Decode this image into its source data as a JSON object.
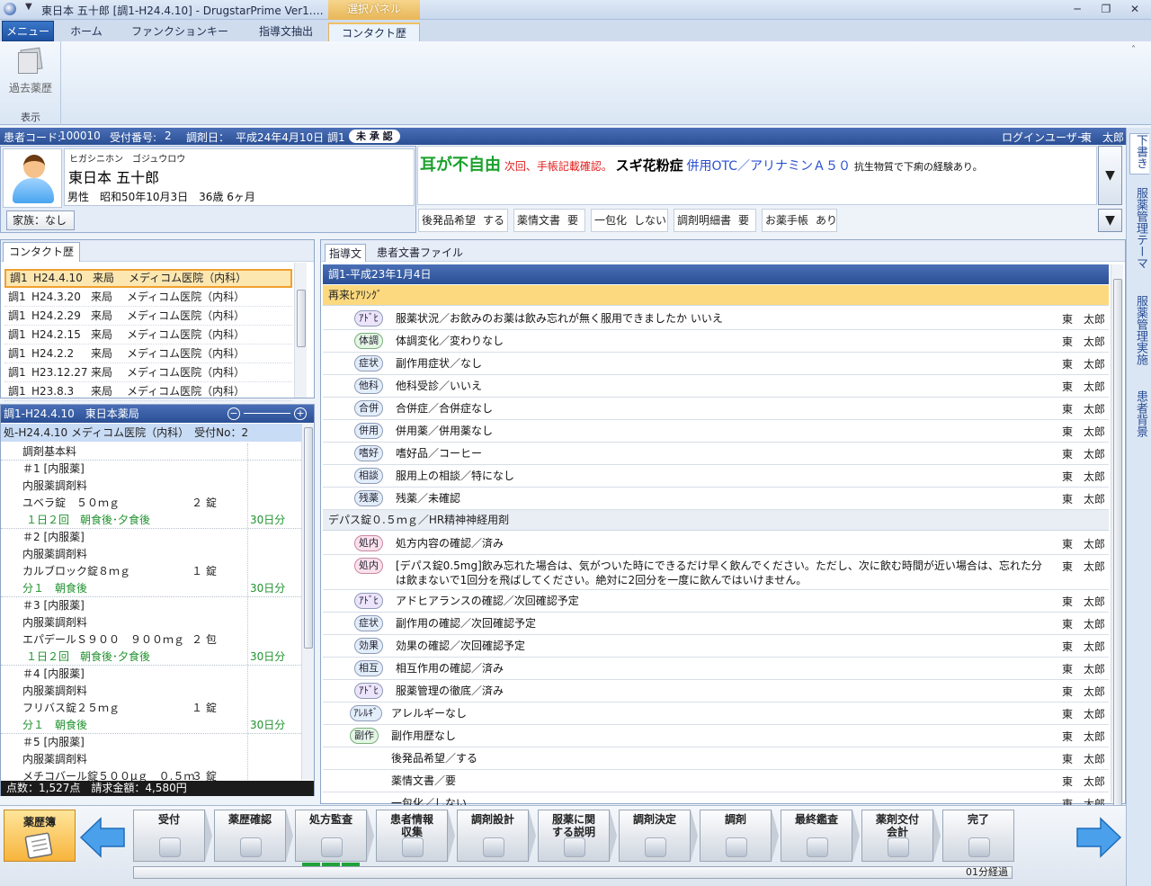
{
  "window": {
    "title": "東日本 五十郎 [調1-H24.4.10] - DrugstarPrime Ver1.…",
    "context_tab": "選択パネル",
    "minimize": "─",
    "restore": "❐",
    "close": "✕"
  },
  "ribbon_tabs": {
    "menu": "メニュー",
    "tabs": [
      "ホーム",
      "ファンクションキー",
      "指導文抽出",
      "コンタクト歴"
    ],
    "active_index": 3
  },
  "ribbon": {
    "button_label": "過去薬歴",
    "group_label": "表示",
    "collapse_glyph": "˄"
  },
  "patient_bar": {
    "code_label": "患者コード:",
    "code": "100010",
    "reception_label": "受付番号:",
    "reception": "2",
    "date_label": "調剤日：",
    "date": "平成24年4月10日",
    "dispense": "調1",
    "status": "未 承 認",
    "login_label": "ログインユーザー:",
    "login_user": "東　太郎"
  },
  "patient": {
    "kana": "ヒガシニホン　ゴジュウロウ",
    "name": "東日本 五十郎",
    "bio": "男性　昭和50年10月3日　36歳 6ヶ月",
    "family": "家族：なし"
  },
  "alert": {
    "a1": "耳が不自由",
    "a2": "次回、手帳記載確認。",
    "a3": "スギ花粉症",
    "a4": "併用OTC／アリナミンＡ５０",
    "a5": "抗生物質で下痢の経験あり。",
    "dropdown_glyph": "▼"
  },
  "flags": [
    {
      "label": "後発品希望",
      "value": "する"
    },
    {
      "label": "薬情文書",
      "value": "要"
    },
    {
      "label": "一包化",
      "value": "しない"
    },
    {
      "label": "調剤明細書",
      "value": "要"
    },
    {
      "label": "お薬手帳",
      "value": "あり"
    }
  ],
  "contact": {
    "tab": "コンタクト歴",
    "rows": [
      {
        "type": "調1",
        "date": "H24.4.10",
        "kind": "来局",
        "clinic": "メディコム医院（内科）"
      },
      {
        "type": "調1",
        "date": "H24.3.20",
        "kind": "来局",
        "clinic": "メディコム医院（内科）"
      },
      {
        "type": "調1",
        "date": "H24.2.29",
        "kind": "来局",
        "clinic": "メディコム医院（内科）"
      },
      {
        "type": "調1",
        "date": "H24.2.15",
        "kind": "来局",
        "clinic": "メディコム医院（内科）"
      },
      {
        "type": "調1",
        "date": "H24.2.2",
        "kind": "来局",
        "clinic": "メディコム医院（内科）"
      },
      {
        "type": "調1",
        "date": "H23.12.27",
        "kind": "来局",
        "clinic": "メディコム医院（内科）"
      },
      {
        "type": "調1",
        "date": "H23.8.3",
        "kind": "来局",
        "clinic": "メディコム医院（内科）"
      }
    ]
  },
  "dispensing": {
    "header": "調1-H24.4.10　東日本薬局",
    "zoom_minus": "−",
    "zoom_plus": "+",
    "rx_header": "処-H24.4.10 メディコム医院（内科）　受付No：2",
    "lines": [
      {
        "text": "調剤基本料",
        "qty": "",
        "days": "",
        "indent": 24,
        "green": false,
        "sep": true
      },
      {
        "text": "＃1 [内服薬]",
        "qty": "",
        "days": "",
        "indent": 24,
        "green": false,
        "sep": false
      },
      {
        "text": "内服薬調剤料",
        "qty": "",
        "days": "",
        "indent": 24,
        "green": false,
        "sep": false
      },
      {
        "text": "ユベラ錠　５０ｍｇ",
        "qty": "２ 錠",
        "days": "",
        "indent": 24,
        "green": false,
        "sep": false
      },
      {
        "text": "１日２回　朝食後･夕食後",
        "qty": "",
        "days": "30日分",
        "indent": 28,
        "green": true,
        "sep": true
      },
      {
        "text": "＃2 [内服薬]",
        "qty": "",
        "days": "",
        "indent": 24,
        "green": false,
        "sep": false
      },
      {
        "text": "内服薬調剤料",
        "qty": "",
        "days": "",
        "indent": 24,
        "green": false,
        "sep": false
      },
      {
        "text": "カルブロック錠８ｍｇ",
        "qty": "１ 錠",
        "days": "",
        "indent": 24,
        "green": false,
        "sep": false
      },
      {
        "text": "分１　朝食後",
        "qty": "",
        "days": "30日分",
        "indent": 24,
        "green": true,
        "sep": true
      },
      {
        "text": "＃3 [内服薬]",
        "qty": "",
        "days": "",
        "indent": 24,
        "green": false,
        "sep": false
      },
      {
        "text": "内服薬調剤料",
        "qty": "",
        "days": "",
        "indent": 24,
        "green": false,
        "sep": false
      },
      {
        "text": "エパデールＳ９００　９００ｍｇ",
        "qty": "２ 包",
        "days": "",
        "indent": 24,
        "green": false,
        "sep": false
      },
      {
        "text": "１日２回　朝食後･夕食後",
        "qty": "",
        "days": "30日分",
        "indent": 28,
        "green": true,
        "sep": true
      },
      {
        "text": "＃4 [内服薬]",
        "qty": "",
        "days": "",
        "indent": 24,
        "green": false,
        "sep": false
      },
      {
        "text": "内服薬調剤料",
        "qty": "",
        "days": "",
        "indent": 24,
        "green": false,
        "sep": false
      },
      {
        "text": "フリバス錠２５ｍｇ",
        "qty": "１ 錠",
        "days": "",
        "indent": 24,
        "green": false,
        "sep": false
      },
      {
        "text": "分１　朝食後",
        "qty": "",
        "days": "30日分",
        "indent": 24,
        "green": true,
        "sep": true
      },
      {
        "text": "＃5 [内服薬]",
        "qty": "",
        "days": "",
        "indent": 24,
        "green": false,
        "sep": false
      },
      {
        "text": "内服薬調剤料",
        "qty": "",
        "days": "",
        "indent": 24,
        "green": false,
        "sep": false
      },
      {
        "text": "メチコバール錠５００μｇ　０.５ｍ",
        "qty": "３ 錠",
        "days": "",
        "indent": 24,
        "green": false,
        "sep": false
      }
    ],
    "total": "点数：1,527点　請求金額：4,580円"
  },
  "guide": {
    "tabs": [
      "指導文",
      "患者文書ファイル"
    ],
    "header": "調1-平成23年1月4日",
    "items": [
      {
        "kind": "sec",
        "style": "yellow",
        "text": "再来ﾋｱﾘﾝｸﾞ"
      },
      {
        "kind": "entry",
        "tag": "ｱﾄﾞﾋ",
        "color": "purple",
        "text": "服薬状況／お飲みのお薬は飲み忘れが無く服用できましたか いいえ",
        "user": "東　太郎",
        "h": 25,
        "tagx": 35
      },
      {
        "kind": "entry",
        "tag": "体調",
        "color": "green",
        "text": "体調変化／変わりなし",
        "user": "東　太郎",
        "h": 25,
        "tagx": 35
      },
      {
        "kind": "entry",
        "tag": "症状",
        "color": "blue",
        "text": "副作用症状／なし",
        "user": "東　太郎",
        "h": 25,
        "tagx": 35
      },
      {
        "kind": "entry",
        "tag": "他科",
        "color": "blue",
        "text": "他科受診／いいえ",
        "user": "東　太郎",
        "h": 25,
        "tagx": 35
      },
      {
        "kind": "entry",
        "tag": "合併",
        "color": "blue",
        "text": "合併症／合併症なし",
        "user": "東　太郎",
        "h": 25,
        "tagx": 35
      },
      {
        "kind": "entry",
        "tag": "併用",
        "color": "blue",
        "text": "併用薬／併用薬なし",
        "user": "東　太郎",
        "h": 25,
        "tagx": 35
      },
      {
        "kind": "entry",
        "tag": "嗜好",
        "color": "blue",
        "text": "嗜好品／コーヒー",
        "user": "東　太郎",
        "h": 25,
        "tagx": 35
      },
      {
        "kind": "entry",
        "tag": "相談",
        "color": "blue",
        "text": "服用上の相談／特になし",
        "user": "東　太郎",
        "h": 25,
        "tagx": 35
      },
      {
        "kind": "entry",
        "tag": "残薬",
        "color": "blue",
        "text": "残薬／未確認",
        "user": "東　太郎",
        "h": 25,
        "tagx": 35
      },
      {
        "kind": "sec",
        "style": "gray",
        "text": "デパス錠０.５ｍｇ／HR精神神経用剤"
      },
      {
        "kind": "entry",
        "tag": "処内",
        "color": "pink",
        "text": "処方内容の確認／済み",
        "user": "東　太郎",
        "h": 25,
        "tagx": 35
      },
      {
        "kind": "entry",
        "tag": "処内",
        "color": "pink",
        "text": "[デパス錠0.5mg]飲み忘れた場合は、気がついた時にできるだけ早く飲んでください。ただし、次に飲む時間が近い場合は、忘れた分は飲まないで1回分を飛ばしてください。絶対に2回分を一度に飲んではいけません。",
        "user": "東　太郎",
        "h": 39,
        "tagx": 35
      },
      {
        "kind": "entry",
        "tag": "ｱﾄﾞﾋ",
        "color": "purple",
        "text": "アドヒアランスの確認／次回確認予定",
        "user": "東　太郎",
        "h": 25,
        "tagx": 35
      },
      {
        "kind": "entry",
        "tag": "症状",
        "color": "blue",
        "text": "副作用の確認／次回確認予定",
        "user": "東　太郎",
        "h": 25,
        "tagx": 35
      },
      {
        "kind": "entry",
        "tag": "効果",
        "color": "blue",
        "text": "効果の確認／次回確認予定",
        "user": "東　太郎",
        "h": 25,
        "tagx": 35
      },
      {
        "kind": "entry",
        "tag": "相互",
        "color": "blue",
        "text": "相互作用の確認／済み",
        "user": "東　太郎",
        "h": 25,
        "tagx": 35
      },
      {
        "kind": "entry",
        "tag": "ｱﾄﾞﾋ",
        "color": "purple",
        "text": "服薬管理の徹底／済み",
        "user": "東　太郎",
        "h": 25,
        "tagx": 35
      },
      {
        "kind": "entry",
        "tag": "ｱﾚﾙｷﾞ",
        "color": "blue",
        "text": "アレルギーなし",
        "user": "東　太郎",
        "h": 25,
        "tagx": 30
      },
      {
        "kind": "entry",
        "tag": "副作",
        "color": "green",
        "text": "副作用歴なし",
        "user": "東　太郎",
        "h": 25,
        "tagx": 30
      },
      {
        "kind": "entry",
        "tag": "",
        "color": "",
        "text": "後発品希望／する",
        "user": "東　太郎",
        "h": 25,
        "tagx": 30
      },
      {
        "kind": "entry",
        "tag": "",
        "color": "",
        "text": "薬情文書／要",
        "user": "東　太郎",
        "h": 25,
        "tagx": 30
      },
      {
        "kind": "entry",
        "tag": "",
        "color": "",
        "text": "一包化／しない",
        "user": "東　太郎",
        "h": 25,
        "tagx": 30
      }
    ]
  },
  "side_tabs": [
    "下書き",
    "服薬管理テーマ",
    "服薬管理実施",
    "患者背景"
  ],
  "workflow": {
    "yakureki": "薬歴簿",
    "steps": [
      "受付",
      "薬歴確認",
      "処方監査",
      "患者情報\n収集",
      "調剤設計",
      "服薬に関\nする説明",
      "調剤決定",
      "調剤",
      "最終鑑査",
      "薬剤交付\n会計",
      "完了"
    ],
    "elapsed": "01分経過"
  }
}
